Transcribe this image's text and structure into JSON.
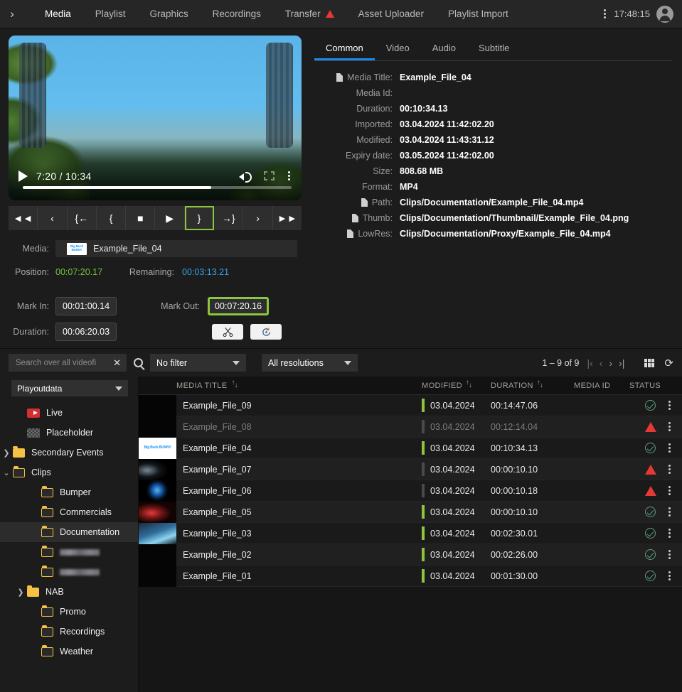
{
  "topnav": {
    "chevron": "›",
    "items": [
      {
        "label": "Media",
        "active": true,
        "warn": false
      },
      {
        "label": "Playlist",
        "active": false,
        "warn": false
      },
      {
        "label": "Graphics",
        "active": false,
        "warn": false
      },
      {
        "label": "Recordings",
        "active": false,
        "warn": false
      },
      {
        "label": "Transfer",
        "active": false,
        "warn": true
      },
      {
        "label": "Asset Uploader",
        "active": false,
        "warn": false
      },
      {
        "label": "Playlist Import",
        "active": false,
        "warn": false
      }
    ],
    "clock": "17:48:15"
  },
  "player": {
    "current_time": "7:20",
    "total_time": "10:34",
    "time_display": "7:20 / 10:34",
    "progress_percent": 70,
    "transport": [
      {
        "name": "rewind",
        "glyph": "◄◄",
        "selected": false
      },
      {
        "name": "step-back",
        "glyph": "‹",
        "selected": false
      },
      {
        "name": "goto-mark-in",
        "glyph": "{←",
        "selected": false
      },
      {
        "name": "set-mark-in",
        "glyph": "{",
        "selected": false
      },
      {
        "name": "stop",
        "glyph": "■",
        "selected": false
      },
      {
        "name": "play",
        "glyph": "▶",
        "selected": false
      },
      {
        "name": "set-mark-out",
        "glyph": "}",
        "selected": true
      },
      {
        "name": "goto-mark-out",
        "glyph": "→}",
        "selected": false
      },
      {
        "name": "step-forward",
        "glyph": "›",
        "selected": false
      },
      {
        "name": "fast-forward",
        "glyph": "►►",
        "selected": false
      }
    ]
  },
  "clip": {
    "media_label": "Media:",
    "media_value": "Example_File_04",
    "thumb_text": "Big Buck BUNNY",
    "position_label": "Position:",
    "position_value": "00:07:20.17",
    "remaining_label": "Remaining:",
    "remaining_value": "00:03:13.21",
    "mark_in_label": "Mark In:",
    "mark_in_value": "00:01:00.14",
    "mark_out_label": "Mark Out:",
    "mark_out_value": "00:07:20.16",
    "duration_label": "Duration:",
    "duration_value": "00:06:20.03",
    "cut_icon": "✂",
    "reset_icon": "↺"
  },
  "metadata": {
    "tabs": [
      {
        "label": "Common",
        "active": true
      },
      {
        "label": "Video",
        "active": false
      },
      {
        "label": "Audio",
        "active": false
      },
      {
        "label": "Subtitle",
        "active": false
      }
    ],
    "fields": [
      {
        "key": "Media Title:",
        "value": "Example_File_04",
        "icon": true
      },
      {
        "key": "Media Id:",
        "value": "",
        "icon": false
      },
      {
        "key": "Duration:",
        "value": "00:10:34.13",
        "icon": false
      },
      {
        "key": "Imported:",
        "value": "03.04.2024 11:42:02.20",
        "icon": false
      },
      {
        "key": "Modified:",
        "value": "03.04.2024 11:43:31.12",
        "icon": false
      },
      {
        "key": "Expiry date:",
        "value": "03.05.2024 11:42:02.00",
        "icon": false
      },
      {
        "key": "Size:",
        "value": "808.68 MB",
        "icon": false
      },
      {
        "key": "Format:",
        "value": "MP4",
        "icon": false
      },
      {
        "key": "Path:",
        "value": "Clips/Documentation/Example_File_04.mp4",
        "icon": true
      },
      {
        "key": "Thumb:",
        "value": "Clips/Documentation/Thumbnail/Example_File_04.png",
        "icon": true
      },
      {
        "key": "LowRes:",
        "value": "Clips/Documentation/Proxy/Example_File_04.mp4",
        "icon": true
      }
    ]
  },
  "toolbar": {
    "search_placeholder": "Search over all videofi",
    "clear_icon": "✕",
    "filter_value": "No filter",
    "resolution_value": "All resolutions",
    "pager_text": "1 – 9 of 9",
    "pager_first": "|‹",
    "pager_prev": "‹",
    "pager_next": "›",
    "pager_last": "›|",
    "refresh_icon": "⟳"
  },
  "tree": {
    "selector_value": "Playoutdata",
    "nodes": [
      {
        "label": "Live",
        "icon": "live",
        "indent": 1,
        "arrow": "",
        "active": false,
        "blurred": false
      },
      {
        "label": "Placeholder",
        "icon": "placeholder",
        "indent": 1,
        "arrow": "",
        "active": false,
        "blurred": false
      },
      {
        "label": "Secondary Events",
        "icon": "folder-solid",
        "indent": 0,
        "arrow": "closed",
        "active": false,
        "blurred": false
      },
      {
        "label": "Clips",
        "icon": "folder-hollow",
        "indent": 0,
        "arrow": "open",
        "active": false,
        "blurred": false
      },
      {
        "label": "Bumper",
        "icon": "folder-hollow",
        "indent": 2,
        "arrow": "",
        "active": false,
        "blurred": false
      },
      {
        "label": "Commercials",
        "icon": "folder-hollow",
        "indent": 2,
        "arrow": "",
        "active": false,
        "blurred": false
      },
      {
        "label": "Documentation",
        "icon": "folder-hollow",
        "indent": 2,
        "arrow": "",
        "active": true,
        "blurred": false
      },
      {
        "label": "",
        "icon": "folder-hollow",
        "indent": 2,
        "arrow": "",
        "active": false,
        "blurred": true
      },
      {
        "label": "",
        "icon": "folder-hollow",
        "indent": 2,
        "arrow": "",
        "active": false,
        "blurred": true
      },
      {
        "label": "NAB",
        "icon": "folder-solid",
        "indent": 1,
        "arrow": "closed",
        "active": false,
        "blurred": false
      },
      {
        "label": "Promo",
        "icon": "folder-hollow",
        "indent": 2,
        "arrow": "",
        "active": false,
        "blurred": false
      },
      {
        "label": "Recordings",
        "icon": "folder-hollow",
        "indent": 2,
        "arrow": "",
        "active": false,
        "blurred": false
      },
      {
        "label": "Weather",
        "icon": "folder-hollow",
        "indent": 2,
        "arrow": "",
        "active": false,
        "blurred": false
      }
    ]
  },
  "table": {
    "columns": [
      {
        "label": "MEDIA TITLE",
        "sortable": true
      },
      {
        "label": "MODIFIED",
        "sortable": true
      },
      {
        "label": "DURATION",
        "sortable": true
      },
      {
        "label": "MEDIA ID",
        "sortable": false
      },
      {
        "label": "STATUS",
        "sortable": false
      }
    ],
    "rows": [
      {
        "title": "Example_File_09",
        "modified": "03.04.2024",
        "duration": "00:14:47.06",
        "media_id": "",
        "status": "ok",
        "bar": true,
        "thumb": "dark",
        "dimmed": false
      },
      {
        "title": "Example_File_08",
        "modified": "03.04.2024",
        "duration": "00:12:14.04",
        "media_id": "",
        "status": "warn",
        "bar": false,
        "thumb": "dark",
        "dimmed": true
      },
      {
        "title": "Example_File_04",
        "modified": "03.04.2024",
        "duration": "00:10:34.13",
        "media_id": "",
        "status": "ok",
        "bar": true,
        "thumb": "bbb",
        "dimmed": false
      },
      {
        "title": "Example_File_07",
        "modified": "03.04.2024",
        "duration": "00:00:10.10",
        "media_id": "",
        "status": "warn",
        "bar": false,
        "thumb": "wire",
        "dimmed": false
      },
      {
        "title": "Example_File_06",
        "modified": "03.04.2024",
        "duration": "00:00:10.18",
        "media_id": "",
        "status": "warn",
        "bar": false,
        "thumb": "globe",
        "dimmed": false
      },
      {
        "title": "Example_File_05",
        "modified": "03.04.2024",
        "duration": "00:00:10.10",
        "media_id": "",
        "status": "ok",
        "bar": true,
        "thumb": "red",
        "dimmed": false
      },
      {
        "title": "Example_File_03",
        "modified": "03.04.2024",
        "duration": "00:02:30.01",
        "media_id": "",
        "status": "ok",
        "bar": true,
        "thumb": "blue",
        "dimmed": false
      },
      {
        "title": "Example_File_02",
        "modified": "03.04.2024",
        "duration": "00:02:26.00",
        "media_id": "",
        "status": "ok",
        "bar": true,
        "thumb": "dark",
        "dimmed": false
      },
      {
        "title": "Example_File_01",
        "modified": "03.04.2024",
        "duration": "00:01:30.00",
        "media_id": "",
        "status": "ok",
        "bar": true,
        "thumb": "dark",
        "dimmed": false
      }
    ]
  },
  "colors": {
    "accent_blue": "#1e88e5",
    "highlight_green": "#8cc63e",
    "position_green": "#6ec83c",
    "remaining_blue": "#3aa0e8",
    "warn_red": "#e53935",
    "folder_yellow": "#f5c244",
    "background": "#1c1c1c"
  }
}
